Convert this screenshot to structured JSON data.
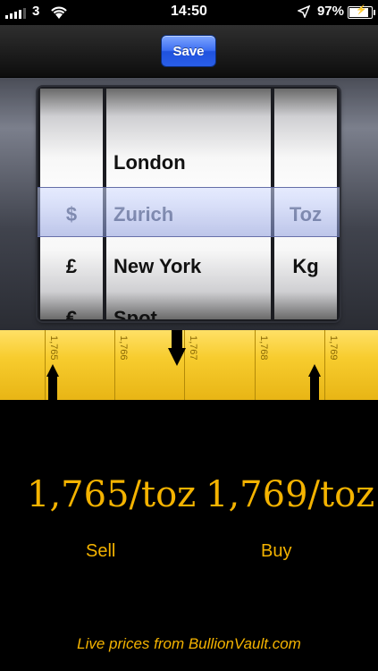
{
  "status_bar": {
    "carrier": "3",
    "time": "14:50",
    "battery": "97%",
    "icons": [
      "signal-icon",
      "wifi-icon",
      "location-icon",
      "battery-icon"
    ]
  },
  "toolbar": {
    "save_label": "Save"
  },
  "picker": {
    "currency_options": [
      "$",
      "£",
      "€"
    ],
    "selected_currency": "$",
    "location_options": [
      "London",
      "Zurich",
      "New York",
      "Spot"
    ],
    "selected_location": "Zurich",
    "unit_options": [
      "Toz",
      "Kg"
    ],
    "selected_unit": "Toz"
  },
  "ruler": {
    "tick_labels": [
      "1,765",
      "1,766",
      "1,767",
      "1,768",
      "1,769"
    ]
  },
  "prices": {
    "sell_value": "1,765/toz",
    "buy_value": "1,769/toz",
    "sell_label": "Sell",
    "buy_label": "Buy"
  },
  "footer": {
    "text": "Live prices from BullionVault.com"
  },
  "colors": {
    "gold": "#f4b300",
    "ruler": "#f7cc2e",
    "save_button": "#2a5ee8"
  }
}
